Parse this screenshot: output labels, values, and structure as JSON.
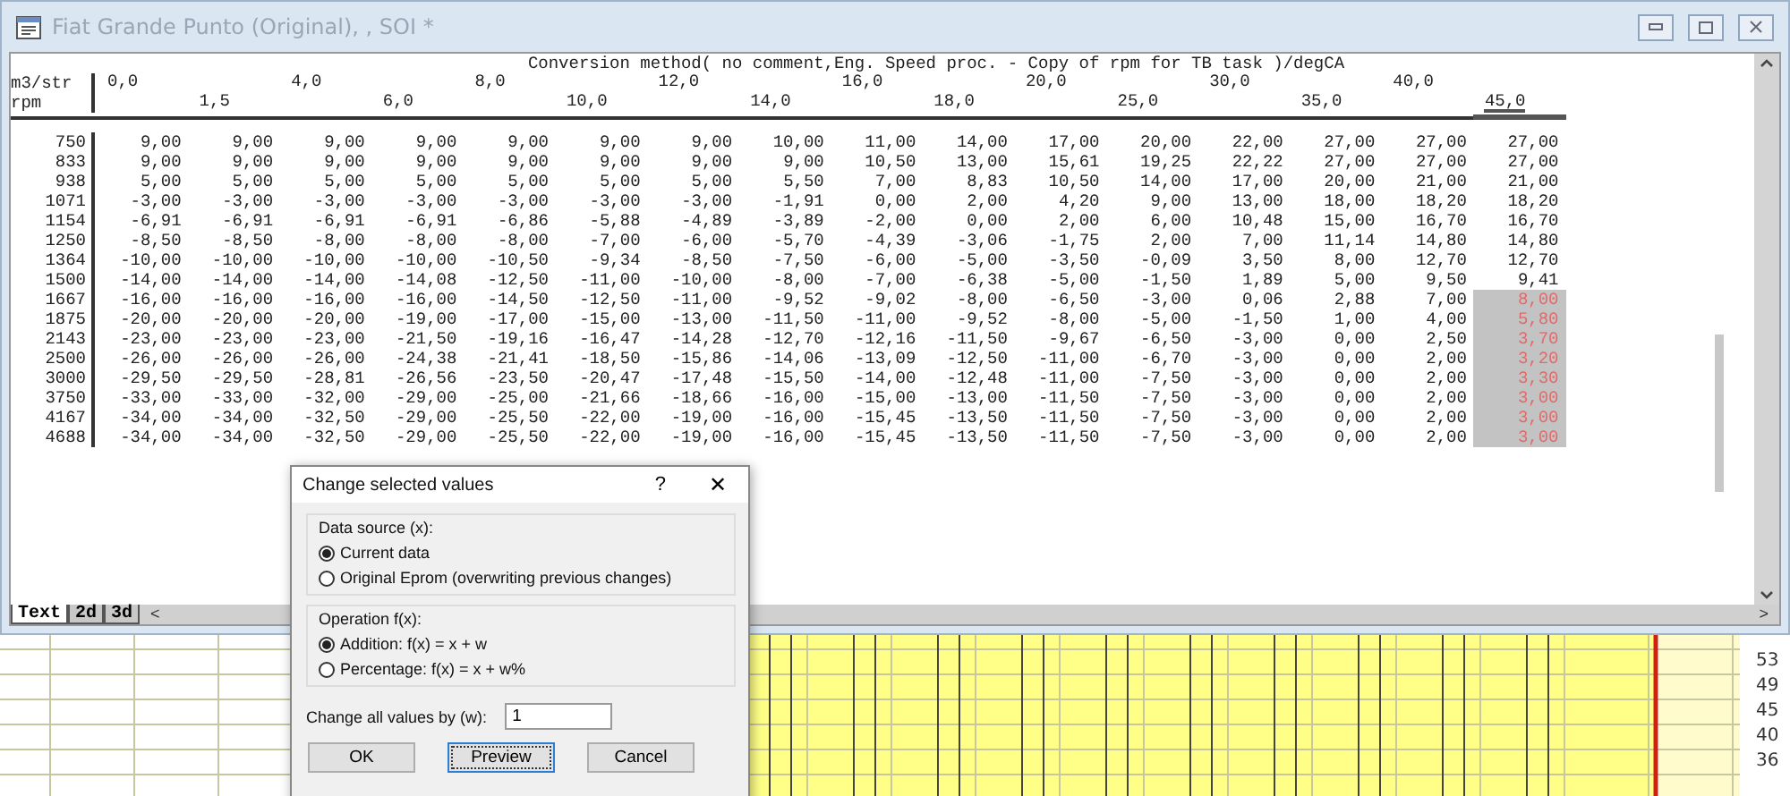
{
  "window": {
    "title": "Fiat Grande Punto (Original), , SOI *",
    "active": false
  },
  "map": {
    "title": "Conversion method( no comment,Eng. Speed proc. - Copy of rpm for TB task )/degCA",
    "x_unit": "m3/str",
    "y_unit": "rpm",
    "columns": [
      {
        "label": "0,0",
        "selected": false
      },
      {
        "label": "1,5",
        "selected": false
      },
      {
        "label": "4,0",
        "selected": false
      },
      {
        "label": "6,0",
        "selected": false
      },
      {
        "label": "8,0",
        "selected": false
      },
      {
        "label": "10,0",
        "selected": false
      },
      {
        "label": "12,0",
        "selected": false
      },
      {
        "label": "14,0",
        "selected": false
      },
      {
        "label": "16,0",
        "selected": false
      },
      {
        "label": "18,0",
        "selected": false
      },
      {
        "label": "20,0",
        "selected": false
      },
      {
        "label": "25,0",
        "selected": false
      },
      {
        "label": "30,0",
        "selected": false
      },
      {
        "label": "35,0",
        "selected": false
      },
      {
        "label": "40,0",
        "selected": false
      },
      {
        "label": "45,0",
        "selected": true
      }
    ],
    "rows": [
      {
        "rpm": "750",
        "cells": [
          {
            "text": "9,00",
            "selected": false
          },
          {
            "text": "9,00",
            "selected": false
          },
          {
            "text": "9,00",
            "selected": false
          },
          {
            "text": "9,00",
            "selected": false
          },
          {
            "text": "9,00",
            "selected": false
          },
          {
            "text": "9,00",
            "selected": false
          },
          {
            "text": "9,00",
            "selected": false
          },
          {
            "text": "10,00",
            "selected": false
          },
          {
            "text": "11,00",
            "selected": false
          },
          {
            "text": "14,00",
            "selected": false
          },
          {
            "text": "17,00",
            "selected": false
          },
          {
            "text": "20,00",
            "selected": false
          },
          {
            "text": "22,00",
            "selected": false
          },
          {
            "text": "27,00",
            "selected": false
          },
          {
            "text": "27,00",
            "selected": false
          },
          {
            "text": "27,00",
            "selected": false
          }
        ]
      },
      {
        "rpm": "833",
        "cells": [
          {
            "text": "9,00",
            "selected": false
          },
          {
            "text": "9,00",
            "selected": false
          },
          {
            "text": "9,00",
            "selected": false
          },
          {
            "text": "9,00",
            "selected": false
          },
          {
            "text": "9,00",
            "selected": false
          },
          {
            "text": "9,00",
            "selected": false
          },
          {
            "text": "9,00",
            "selected": false
          },
          {
            "text": "9,00",
            "selected": false
          },
          {
            "text": "10,50",
            "selected": false
          },
          {
            "text": "13,00",
            "selected": false
          },
          {
            "text": "15,61",
            "selected": false
          },
          {
            "text": "19,25",
            "selected": false
          },
          {
            "text": "22,22",
            "selected": false
          },
          {
            "text": "27,00",
            "selected": false
          },
          {
            "text": "27,00",
            "selected": false
          },
          {
            "text": "27,00",
            "selected": false
          }
        ]
      },
      {
        "rpm": "938",
        "cells": [
          {
            "text": "5,00",
            "selected": false
          },
          {
            "text": "5,00",
            "selected": false
          },
          {
            "text": "5,00",
            "selected": false
          },
          {
            "text": "5,00",
            "selected": false
          },
          {
            "text": "5,00",
            "selected": false
          },
          {
            "text": "5,00",
            "selected": false
          },
          {
            "text": "5,00",
            "selected": false
          },
          {
            "text": "5,50",
            "selected": false
          },
          {
            "text": "7,00",
            "selected": false
          },
          {
            "text": "8,83",
            "selected": false
          },
          {
            "text": "10,50",
            "selected": false
          },
          {
            "text": "14,00",
            "selected": false
          },
          {
            "text": "17,00",
            "selected": false
          },
          {
            "text": "20,00",
            "selected": false
          },
          {
            "text": "21,00",
            "selected": false
          },
          {
            "text": "21,00",
            "selected": false
          }
        ]
      },
      {
        "rpm": "1071",
        "cells": [
          {
            "text": "-3,00",
            "selected": false
          },
          {
            "text": "-3,00",
            "selected": false
          },
          {
            "text": "-3,00",
            "selected": false
          },
          {
            "text": "-3,00",
            "selected": false
          },
          {
            "text": "-3,00",
            "selected": false
          },
          {
            "text": "-3,00",
            "selected": false
          },
          {
            "text": "-3,00",
            "selected": false
          },
          {
            "text": "-1,91",
            "selected": false
          },
          {
            "text": "0,00",
            "selected": false
          },
          {
            "text": "2,00",
            "selected": false
          },
          {
            "text": "4,20",
            "selected": false
          },
          {
            "text": "9,00",
            "selected": false
          },
          {
            "text": "13,00",
            "selected": false
          },
          {
            "text": "18,00",
            "selected": false
          },
          {
            "text": "18,20",
            "selected": false
          },
          {
            "text": "18,20",
            "selected": false
          }
        ]
      },
      {
        "rpm": "1154",
        "cells": [
          {
            "text": "-6,91",
            "selected": false
          },
          {
            "text": "-6,91",
            "selected": false
          },
          {
            "text": "-6,91",
            "selected": false
          },
          {
            "text": "-6,91",
            "selected": false
          },
          {
            "text": "-6,86",
            "selected": false
          },
          {
            "text": "-5,88",
            "selected": false
          },
          {
            "text": "-4,89",
            "selected": false
          },
          {
            "text": "-3,89",
            "selected": false
          },
          {
            "text": "-2,00",
            "selected": false
          },
          {
            "text": "0,00",
            "selected": false
          },
          {
            "text": "2,00",
            "selected": false
          },
          {
            "text": "6,00",
            "selected": false
          },
          {
            "text": "10,48",
            "selected": false
          },
          {
            "text": "15,00",
            "selected": false
          },
          {
            "text": "16,70",
            "selected": false
          },
          {
            "text": "16,70",
            "selected": false
          }
        ]
      },
      {
        "rpm": "1250",
        "cells": [
          {
            "text": "-8,50",
            "selected": false
          },
          {
            "text": "-8,50",
            "selected": false
          },
          {
            "text": "-8,00",
            "selected": false
          },
          {
            "text": "-8,00",
            "selected": false
          },
          {
            "text": "-8,00",
            "selected": false
          },
          {
            "text": "-7,00",
            "selected": false
          },
          {
            "text": "-6,00",
            "selected": false
          },
          {
            "text": "-5,70",
            "selected": false
          },
          {
            "text": "-4,39",
            "selected": false
          },
          {
            "text": "-3,06",
            "selected": false
          },
          {
            "text": "-1,75",
            "selected": false
          },
          {
            "text": "2,00",
            "selected": false
          },
          {
            "text": "7,00",
            "selected": false
          },
          {
            "text": "11,14",
            "selected": false
          },
          {
            "text": "14,80",
            "selected": false
          },
          {
            "text": "14,80",
            "selected": false
          }
        ]
      },
      {
        "rpm": "1364",
        "cells": [
          {
            "text": "-10,00",
            "selected": false
          },
          {
            "text": "-10,00",
            "selected": false
          },
          {
            "text": "-10,00",
            "selected": false
          },
          {
            "text": "-10,00",
            "selected": false
          },
          {
            "text": "-10,50",
            "selected": false
          },
          {
            "text": "-9,34",
            "selected": false
          },
          {
            "text": "-8,50",
            "selected": false
          },
          {
            "text": "-7,50",
            "selected": false
          },
          {
            "text": "-6,00",
            "selected": false
          },
          {
            "text": "-5,00",
            "selected": false
          },
          {
            "text": "-3,50",
            "selected": false
          },
          {
            "text": "-0,09",
            "selected": false
          },
          {
            "text": "3,50",
            "selected": false
          },
          {
            "text": "8,00",
            "selected": false
          },
          {
            "text": "12,70",
            "selected": false
          },
          {
            "text": "12,70",
            "selected": false
          }
        ]
      },
      {
        "rpm": "1500",
        "cells": [
          {
            "text": "-14,00",
            "selected": false
          },
          {
            "text": "-14,00",
            "selected": false
          },
          {
            "text": "-14,00",
            "selected": false
          },
          {
            "text": "-14,08",
            "selected": false
          },
          {
            "text": "-12,50",
            "selected": false
          },
          {
            "text": "-11,00",
            "selected": false
          },
          {
            "text": "-10,00",
            "selected": false
          },
          {
            "text": "-8,00",
            "selected": false
          },
          {
            "text": "-7,00",
            "selected": false
          },
          {
            "text": "-6,38",
            "selected": false
          },
          {
            "text": "-5,00",
            "selected": false
          },
          {
            "text": "-1,50",
            "selected": false
          },
          {
            "text": "1,89",
            "selected": false
          },
          {
            "text": "5,00",
            "selected": false
          },
          {
            "text": "9,50",
            "selected": false
          },
          {
            "text": "9,41",
            "selected": false
          }
        ]
      },
      {
        "rpm": "1667",
        "cells": [
          {
            "text": "-16,00",
            "selected": false
          },
          {
            "text": "-16,00",
            "selected": false
          },
          {
            "text": "-16,00",
            "selected": false
          },
          {
            "text": "-16,00",
            "selected": false
          },
          {
            "text": "-14,50",
            "selected": false
          },
          {
            "text": "-12,50",
            "selected": false
          },
          {
            "text": "-11,00",
            "selected": false
          },
          {
            "text": "-9,52",
            "selected": false
          },
          {
            "text": "-9,02",
            "selected": false
          },
          {
            "text": "-8,00",
            "selected": false
          },
          {
            "text": "-6,50",
            "selected": false
          },
          {
            "text": "-3,00",
            "selected": false
          },
          {
            "text": "0,06",
            "selected": false
          },
          {
            "text": "2,88",
            "selected": false
          },
          {
            "text": "7,00",
            "selected": false
          },
          {
            "text": "8,00",
            "selected": true
          }
        ]
      },
      {
        "rpm": "1875",
        "cells": [
          {
            "text": "-20,00",
            "selected": false
          },
          {
            "text": "-20,00",
            "selected": false
          },
          {
            "text": "-20,00",
            "selected": false
          },
          {
            "text": "-19,00",
            "selected": false
          },
          {
            "text": "-17,00",
            "selected": false
          },
          {
            "text": "-15,00",
            "selected": false
          },
          {
            "text": "-13,00",
            "selected": false
          },
          {
            "text": "-11,50",
            "selected": false
          },
          {
            "text": "-11,00",
            "selected": false
          },
          {
            "text": "-9,52",
            "selected": false
          },
          {
            "text": "-8,00",
            "selected": false
          },
          {
            "text": "-5,00",
            "selected": false
          },
          {
            "text": "-1,50",
            "selected": false
          },
          {
            "text": "1,00",
            "selected": false
          },
          {
            "text": "4,00",
            "selected": false
          },
          {
            "text": "5,80",
            "selected": true
          }
        ]
      },
      {
        "rpm": "2143",
        "cells": [
          {
            "text": "-23,00",
            "selected": false
          },
          {
            "text": "-23,00",
            "selected": false
          },
          {
            "text": "-23,00",
            "selected": false
          },
          {
            "text": "-21,50",
            "selected": false
          },
          {
            "text": "-19,16",
            "selected": false
          },
          {
            "text": "-16,47",
            "selected": false
          },
          {
            "text": "-14,28",
            "selected": false
          },
          {
            "text": "-12,70",
            "selected": false
          },
          {
            "text": "-12,16",
            "selected": false
          },
          {
            "text": "-11,50",
            "selected": false
          },
          {
            "text": "-9,67",
            "selected": false
          },
          {
            "text": "-6,50",
            "selected": false
          },
          {
            "text": "-3,00",
            "selected": false
          },
          {
            "text": "0,00",
            "selected": false
          },
          {
            "text": "2,50",
            "selected": false
          },
          {
            "text": "3,70",
            "selected": true
          }
        ]
      },
      {
        "rpm": "2500",
        "cells": [
          {
            "text": "-26,00",
            "selected": false
          },
          {
            "text": "-26,00",
            "selected": false
          },
          {
            "text": "-26,00",
            "selected": false
          },
          {
            "text": "-24,38",
            "selected": false
          },
          {
            "text": "-21,41",
            "selected": false
          },
          {
            "text": "-18,50",
            "selected": false
          },
          {
            "text": "-15,86",
            "selected": false
          },
          {
            "text": "-14,06",
            "selected": false
          },
          {
            "text": "-13,09",
            "selected": false
          },
          {
            "text": "-12,50",
            "selected": false
          },
          {
            "text": "-11,00",
            "selected": false
          },
          {
            "text": "-6,70",
            "selected": false
          },
          {
            "text": "-3,00",
            "selected": false
          },
          {
            "text": "0,00",
            "selected": false
          },
          {
            "text": "2,00",
            "selected": false
          },
          {
            "text": "3,20",
            "selected": true
          }
        ]
      },
      {
        "rpm": "3000",
        "cells": [
          {
            "text": "-29,50",
            "selected": false
          },
          {
            "text": "-29,50",
            "selected": false
          },
          {
            "text": "-28,81",
            "selected": false
          },
          {
            "text": "-26,56",
            "selected": false
          },
          {
            "text": "-23,50",
            "selected": false
          },
          {
            "text": "-20,47",
            "selected": false
          },
          {
            "text": "-17,48",
            "selected": false
          },
          {
            "text": "-15,50",
            "selected": false
          },
          {
            "text": "-14,00",
            "selected": false
          },
          {
            "text": "-12,48",
            "selected": false
          },
          {
            "text": "-11,00",
            "selected": false
          },
          {
            "text": "-7,50",
            "selected": false
          },
          {
            "text": "-3,00",
            "selected": false
          },
          {
            "text": "0,00",
            "selected": false
          },
          {
            "text": "2,00",
            "selected": false
          },
          {
            "text": "3,30",
            "selected": true
          }
        ]
      },
      {
        "rpm": "3750",
        "cells": [
          {
            "text": "-33,00",
            "selected": false
          },
          {
            "text": "-33,00",
            "selected": false
          },
          {
            "text": "-32,00",
            "selected": false
          },
          {
            "text": "-29,00",
            "selected": false
          },
          {
            "text": "-25,00",
            "selected": false
          },
          {
            "text": "-21,66",
            "selected": false
          },
          {
            "text": "-18,66",
            "selected": false
          },
          {
            "text": "-16,00",
            "selected": false
          },
          {
            "text": "-15,00",
            "selected": false
          },
          {
            "text": "-13,00",
            "selected": false
          },
          {
            "text": "-11,50",
            "selected": false
          },
          {
            "text": "-7,50",
            "selected": false
          },
          {
            "text": "-3,00",
            "selected": false
          },
          {
            "text": "0,00",
            "selected": false
          },
          {
            "text": "2,00",
            "selected": false
          },
          {
            "text": "3,00",
            "selected": true
          }
        ]
      },
      {
        "rpm": "4167",
        "cells": [
          {
            "text": "-34,00",
            "selected": false
          },
          {
            "text": "-34,00",
            "selected": false
          },
          {
            "text": "-32,50",
            "selected": false
          },
          {
            "text": "-29,00",
            "selected": false
          },
          {
            "text": "-25,50",
            "selected": false
          },
          {
            "text": "-22,00",
            "selected": false
          },
          {
            "text": "-19,00",
            "selected": false
          },
          {
            "text": "-16,00",
            "selected": false
          },
          {
            "text": "-15,45",
            "selected": false
          },
          {
            "text": "-13,50",
            "selected": false
          },
          {
            "text": "-11,50",
            "selected": false
          },
          {
            "text": "-7,50",
            "selected": false
          },
          {
            "text": "-3,00",
            "selected": false
          },
          {
            "text": "0,00",
            "selected": false
          },
          {
            "text": "2,00",
            "selected": false
          },
          {
            "text": "3,00",
            "selected": true
          }
        ]
      },
      {
        "rpm": "4688",
        "cells": [
          {
            "text": "-34,00",
            "selected": false
          },
          {
            "text": "-34,00",
            "selected": false
          },
          {
            "text": "-32,50",
            "selected": false
          },
          {
            "text": "-29,00",
            "selected": false
          },
          {
            "text": "-25,50",
            "selected": false
          },
          {
            "text": "-22,00",
            "selected": false
          },
          {
            "text": "-19,00",
            "selected": false
          },
          {
            "text": "-16,00",
            "selected": false
          },
          {
            "text": "-15,45",
            "selected": false
          },
          {
            "text": "-13,50",
            "selected": false
          },
          {
            "text": "-11,50",
            "selected": false
          },
          {
            "text": "-7,50",
            "selected": false
          },
          {
            "text": "-3,00",
            "selected": false
          },
          {
            "text": "0,00",
            "selected": false
          },
          {
            "text": "2,00",
            "selected": false
          },
          {
            "text": "3,00",
            "selected": true
          }
        ]
      }
    ]
  },
  "view_tabs": [
    {
      "label": "Text",
      "selected": true
    },
    {
      "label": "2d",
      "selected": false
    },
    {
      "label": "3d",
      "selected": false
    }
  ],
  "scroll_left": "<",
  "scroll_right": ">",
  "background_sheet": {
    "row_numbers": [
      "53",
      "49",
      "45",
      "40",
      "36"
    ]
  },
  "dialog": {
    "title": "Change selected values",
    "help": "?",
    "close": "✕",
    "groups": [
      {
        "title": "Data source (x):",
        "options": [
          {
            "label": "Current data",
            "selected": true
          },
          {
            "label": "Original Eprom (overwriting previous changes)",
            "selected": false
          }
        ]
      },
      {
        "title": "Operation f(x):",
        "options": [
          {
            "label": "Addition: f(x) = x + w",
            "selected": true
          },
          {
            "label": "Percentage: f(x) = x + w%",
            "selected": false
          }
        ]
      }
    ],
    "amount": {
      "label": "Change all values by (w):",
      "value": "1"
    },
    "buttons": [
      {
        "label": "OK",
        "default": false
      },
      {
        "label": "Preview",
        "default": true
      },
      {
        "label": "Cancel",
        "default": false
      }
    ]
  }
}
